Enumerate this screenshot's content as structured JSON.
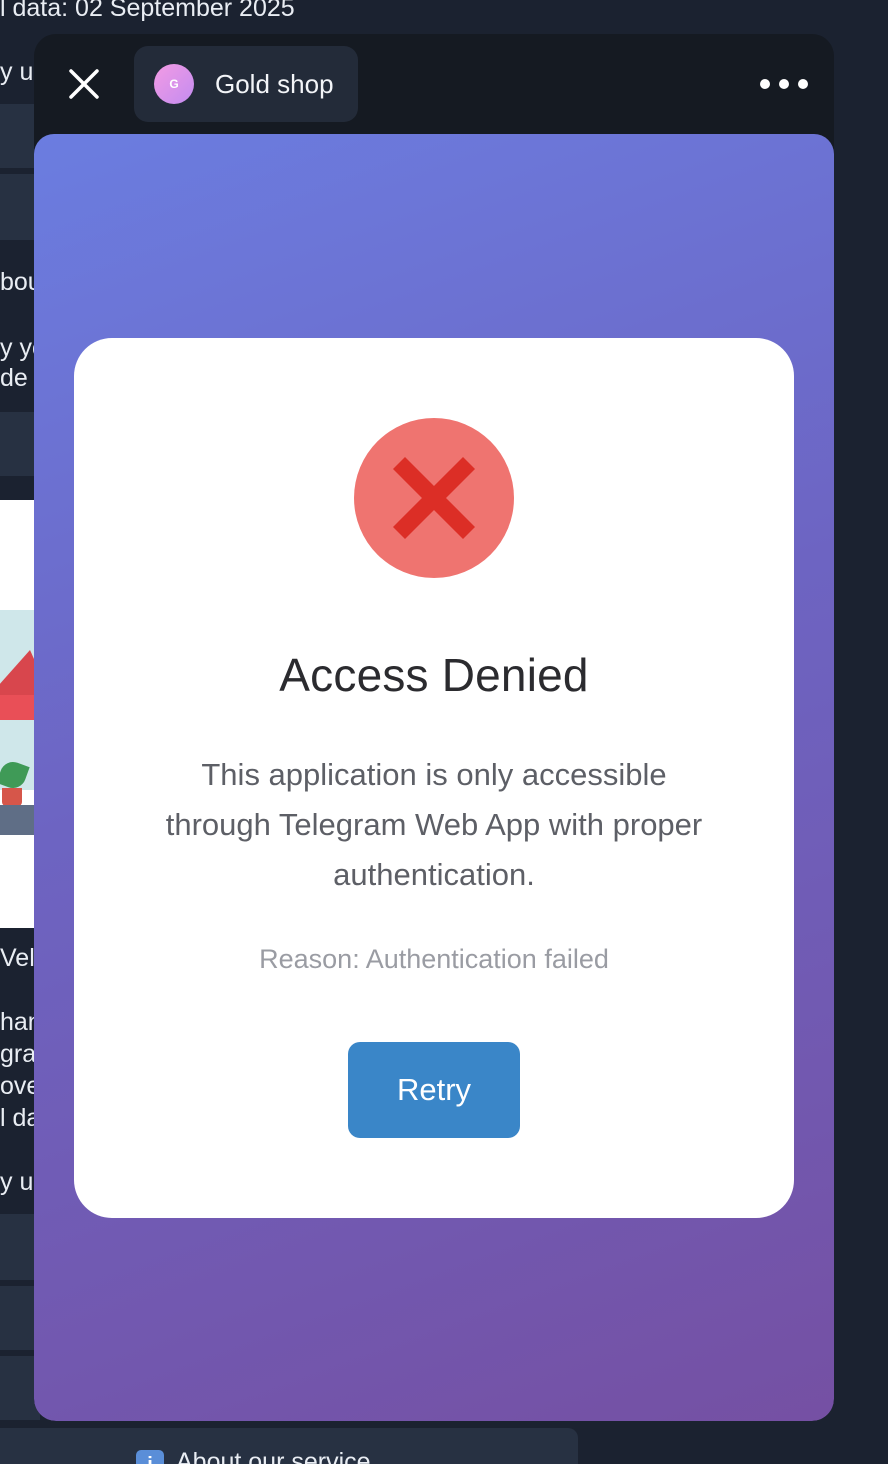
{
  "background_chat": {
    "date_line": "l data: 02 September 2025",
    "fragments": [
      "y us",
      "bou",
      "y you",
      "de",
      "Velc",
      "han",
      "gran",
      "ove",
      "l da",
      "y us"
    ],
    "bottom_button": {
      "label": "About our service",
      "icon": "info-icon"
    }
  },
  "header": {
    "close_icon": "close-icon",
    "bot_avatar_letter": "G",
    "bot_name": "Gold shop",
    "menu_icon": "more-horizontal-icon"
  },
  "error_card": {
    "icon": "error-x-icon",
    "title": "Access Denied",
    "message": "This application is only accessible through Telegram Web App with proper authentication.",
    "reason": "Reason: Authentication failed",
    "retry_label": "Retry"
  },
  "colors": {
    "gradient_start": "#6b7de0",
    "gradient_end": "#7550a3",
    "error_circle": "#ef7470",
    "error_x": "#dc2e26",
    "retry_button": "#3a86c8"
  }
}
